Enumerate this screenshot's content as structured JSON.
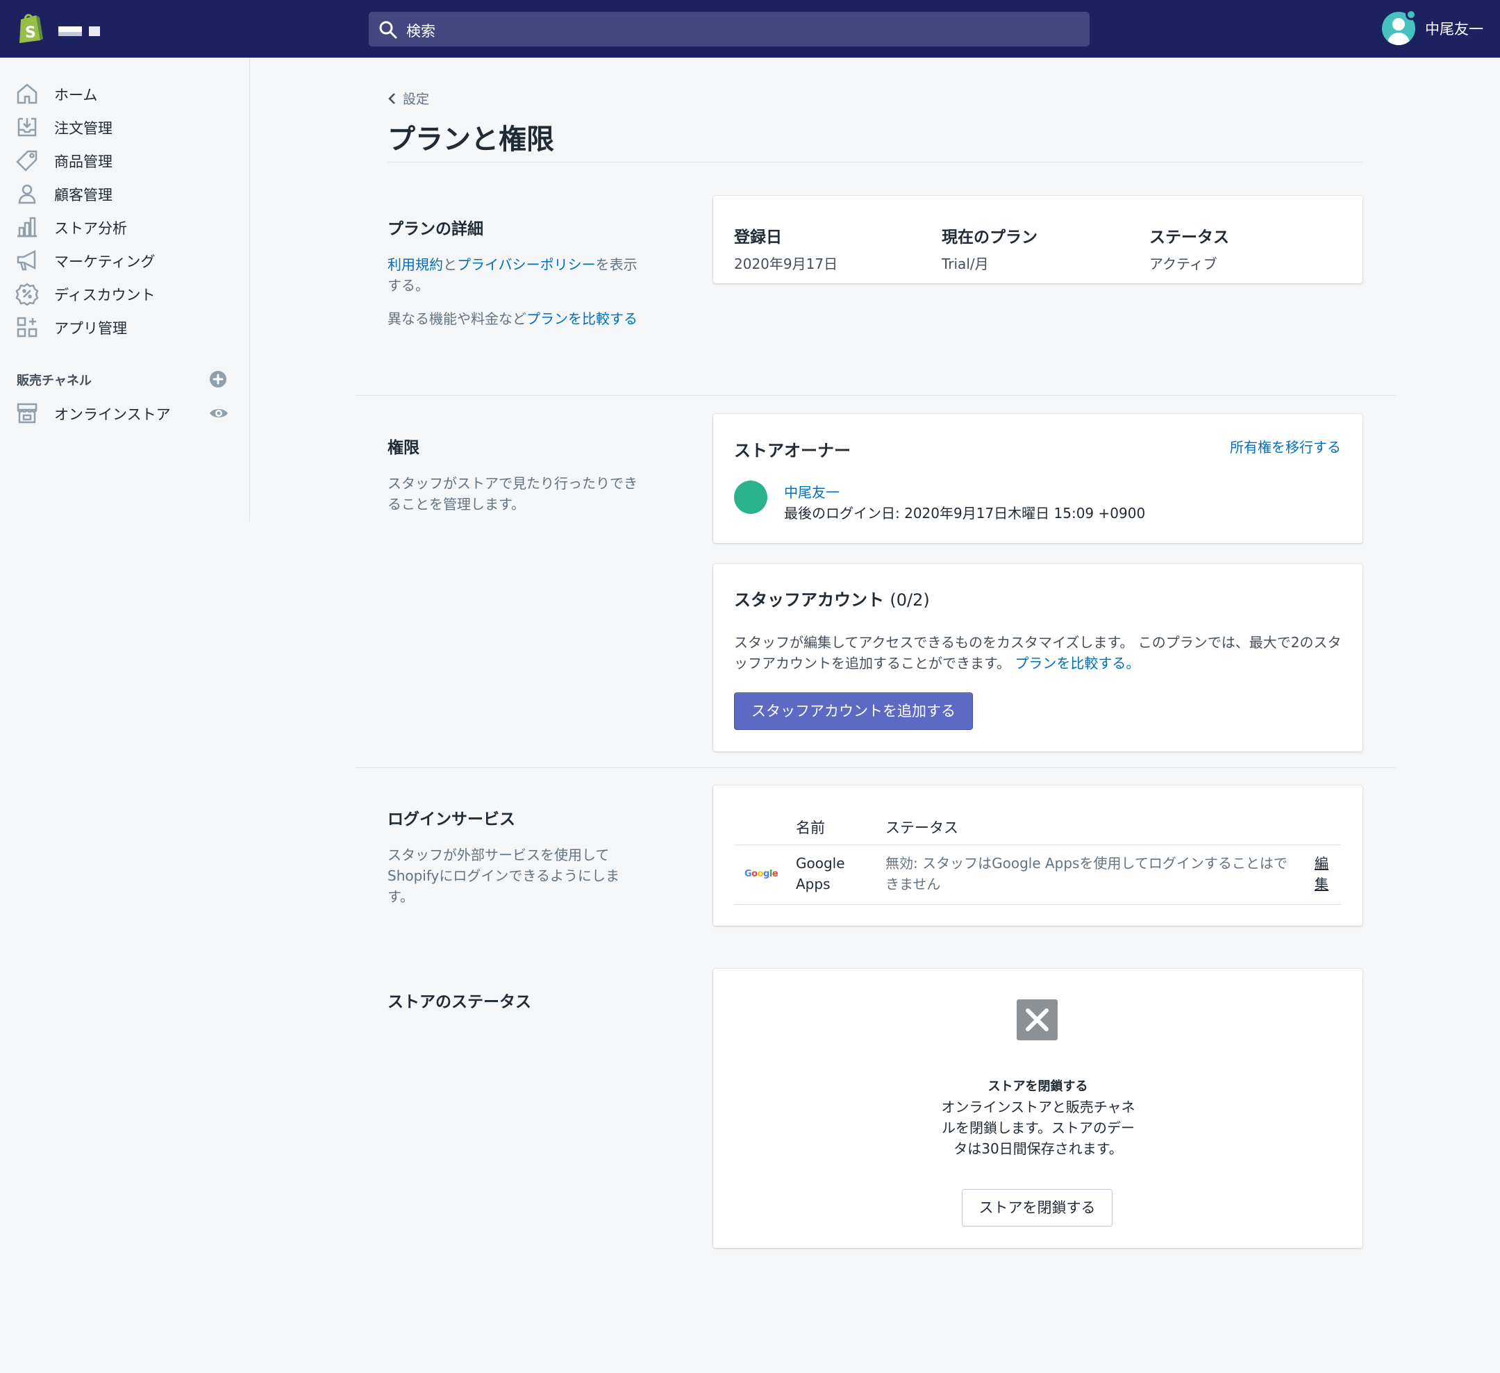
{
  "topbar": {
    "search_placeholder": "検索",
    "user_name": "中尾友一"
  },
  "sidebar": {
    "items": [
      {
        "label": "ホーム",
        "icon": "home-icon"
      },
      {
        "label": "注文管理",
        "icon": "orders-inbox-icon"
      },
      {
        "label": "商品管理",
        "icon": "tag-icon"
      },
      {
        "label": "顧客管理",
        "icon": "person-icon"
      },
      {
        "label": "ストア分析",
        "icon": "bar-chart-icon"
      },
      {
        "label": "マーケティング",
        "icon": "megaphone-icon"
      },
      {
        "label": "ディスカウント",
        "icon": "discount-icon"
      },
      {
        "label": "アプリ管理",
        "icon": "apps-grid-icon"
      }
    ],
    "channels_title": "販売チャネル",
    "channels": [
      {
        "label": "オンラインストア",
        "icon": "storefront-icon"
      }
    ]
  },
  "page": {
    "back_label": "設定",
    "title": "プランと権限"
  },
  "plan": {
    "title": "プランの詳細",
    "desc1_link1": "利用規約",
    "desc1_mid": "と",
    "desc1_link2": "プライバシーポリシー",
    "desc1_tail": "を表示する。",
    "desc2_head": "異なる機能や料金など",
    "desc2_link": "プランを比較する",
    "fields": [
      {
        "label": "登録日",
        "value": "2020年9月17日"
      },
      {
        "label": "現在のプラン",
        "value": "Trial/月"
      },
      {
        "label": "ステータス",
        "value": "アクティブ"
      }
    ]
  },
  "permissions": {
    "title": "権限",
    "desc": "スタッフがストアで見たり行ったりできることを管理します。",
    "owner_card_title": "ストアオーナー",
    "transfer_link": "所有権を移行する",
    "owner_name": "中尾友一",
    "owner_last_login": "最後のログイン日: 2020年9月17日木曜日 15:09 +0900",
    "staff_title": "スタッフアカウント",
    "staff_count": "(0/2)",
    "staff_desc": "スタッフが編集してアクセスできるものをカスタマイズします。 このプランでは、最大で2のスタッフアカウントを追加することができます。",
    "staff_desc_link": "プランを比較する。",
    "add_staff_button": "スタッフアカウントを追加する"
  },
  "login_services": {
    "title": "ログインサービス",
    "desc": "スタッフが外部サービスを使用してShopifyにログインできるようにします。",
    "col_name": "名前",
    "col_status": "ステータス",
    "rows": [
      {
        "logo": "Google",
        "name": "Google Apps",
        "status": "無効: スタッフはGoogle Appsを使用してログインすることはできません",
        "action": "編集"
      }
    ]
  },
  "store_status": {
    "title": "ストアのステータス",
    "close_title": "ストアを閉鎖する",
    "close_desc": "オンラインストアと販売チャネルを閉鎖します。ストアのデータは30日間保存されます。",
    "close_button": "ストアを閉鎖する"
  },
  "colors": {
    "topbar": "#1c2260",
    "search": "#43467f",
    "primary": "#5c6ac4",
    "link": "#006fbb",
    "owner_avatar": "#2ab38d"
  }
}
